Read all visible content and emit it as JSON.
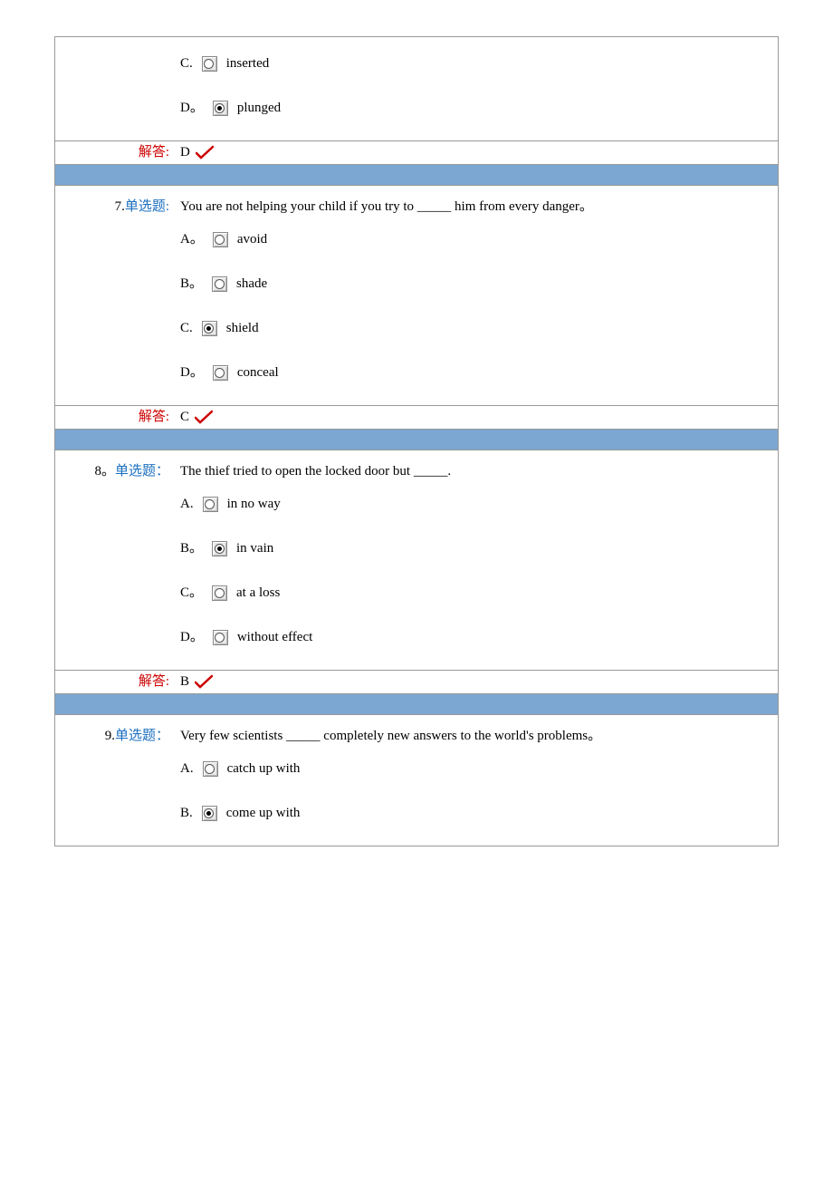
{
  "labels": {
    "answer": "解答:"
  },
  "q6": {
    "options": {
      "c": {
        "letter": "C.",
        "text": "inserted",
        "selected": false
      },
      "d": {
        "letter": "D。",
        "text": "plunged",
        "selected": true
      }
    },
    "answer_letter": "D"
  },
  "q7": {
    "number_prefix": "7.",
    "type": "单选题:",
    "stem": "You are not helping your child if you try to _____ him from every danger。",
    "options": {
      "a": {
        "letter": "A。",
        "text": "avoid",
        "selected": false
      },
      "b": {
        "letter": "B。",
        "text": "shade",
        "selected": false
      },
      "c": {
        "letter": "C.",
        "text": "shield",
        "selected": true
      },
      "d": {
        "letter": "D。",
        "text": "conceal",
        "selected": false
      }
    },
    "answer_letter": "C"
  },
  "q8": {
    "number_prefix": "8。",
    "type": "单选题：",
    "stem": "The thief tried to open the locked door but _____.",
    "options": {
      "a": {
        "letter": "A.",
        "text": "in no way",
        "selected": false
      },
      "b": {
        "letter": "B。",
        "text": "in vain",
        "selected": true
      },
      "c": {
        "letter": "C。",
        "text": "at a loss",
        "selected": false
      },
      "d": {
        "letter": "D。",
        "text": "without effect",
        "selected": false
      }
    },
    "answer_letter": "B"
  },
  "q9": {
    "number_prefix": "9.",
    "type": "单选题：",
    "stem": "Very few scientists _____ completely new answers to the world's problems。",
    "options": {
      "a": {
        "letter": "A.",
        "text": "catch up with",
        "selected": false
      },
      "b": {
        "letter": "B.",
        "text": "come up with",
        "selected": true
      }
    }
  }
}
